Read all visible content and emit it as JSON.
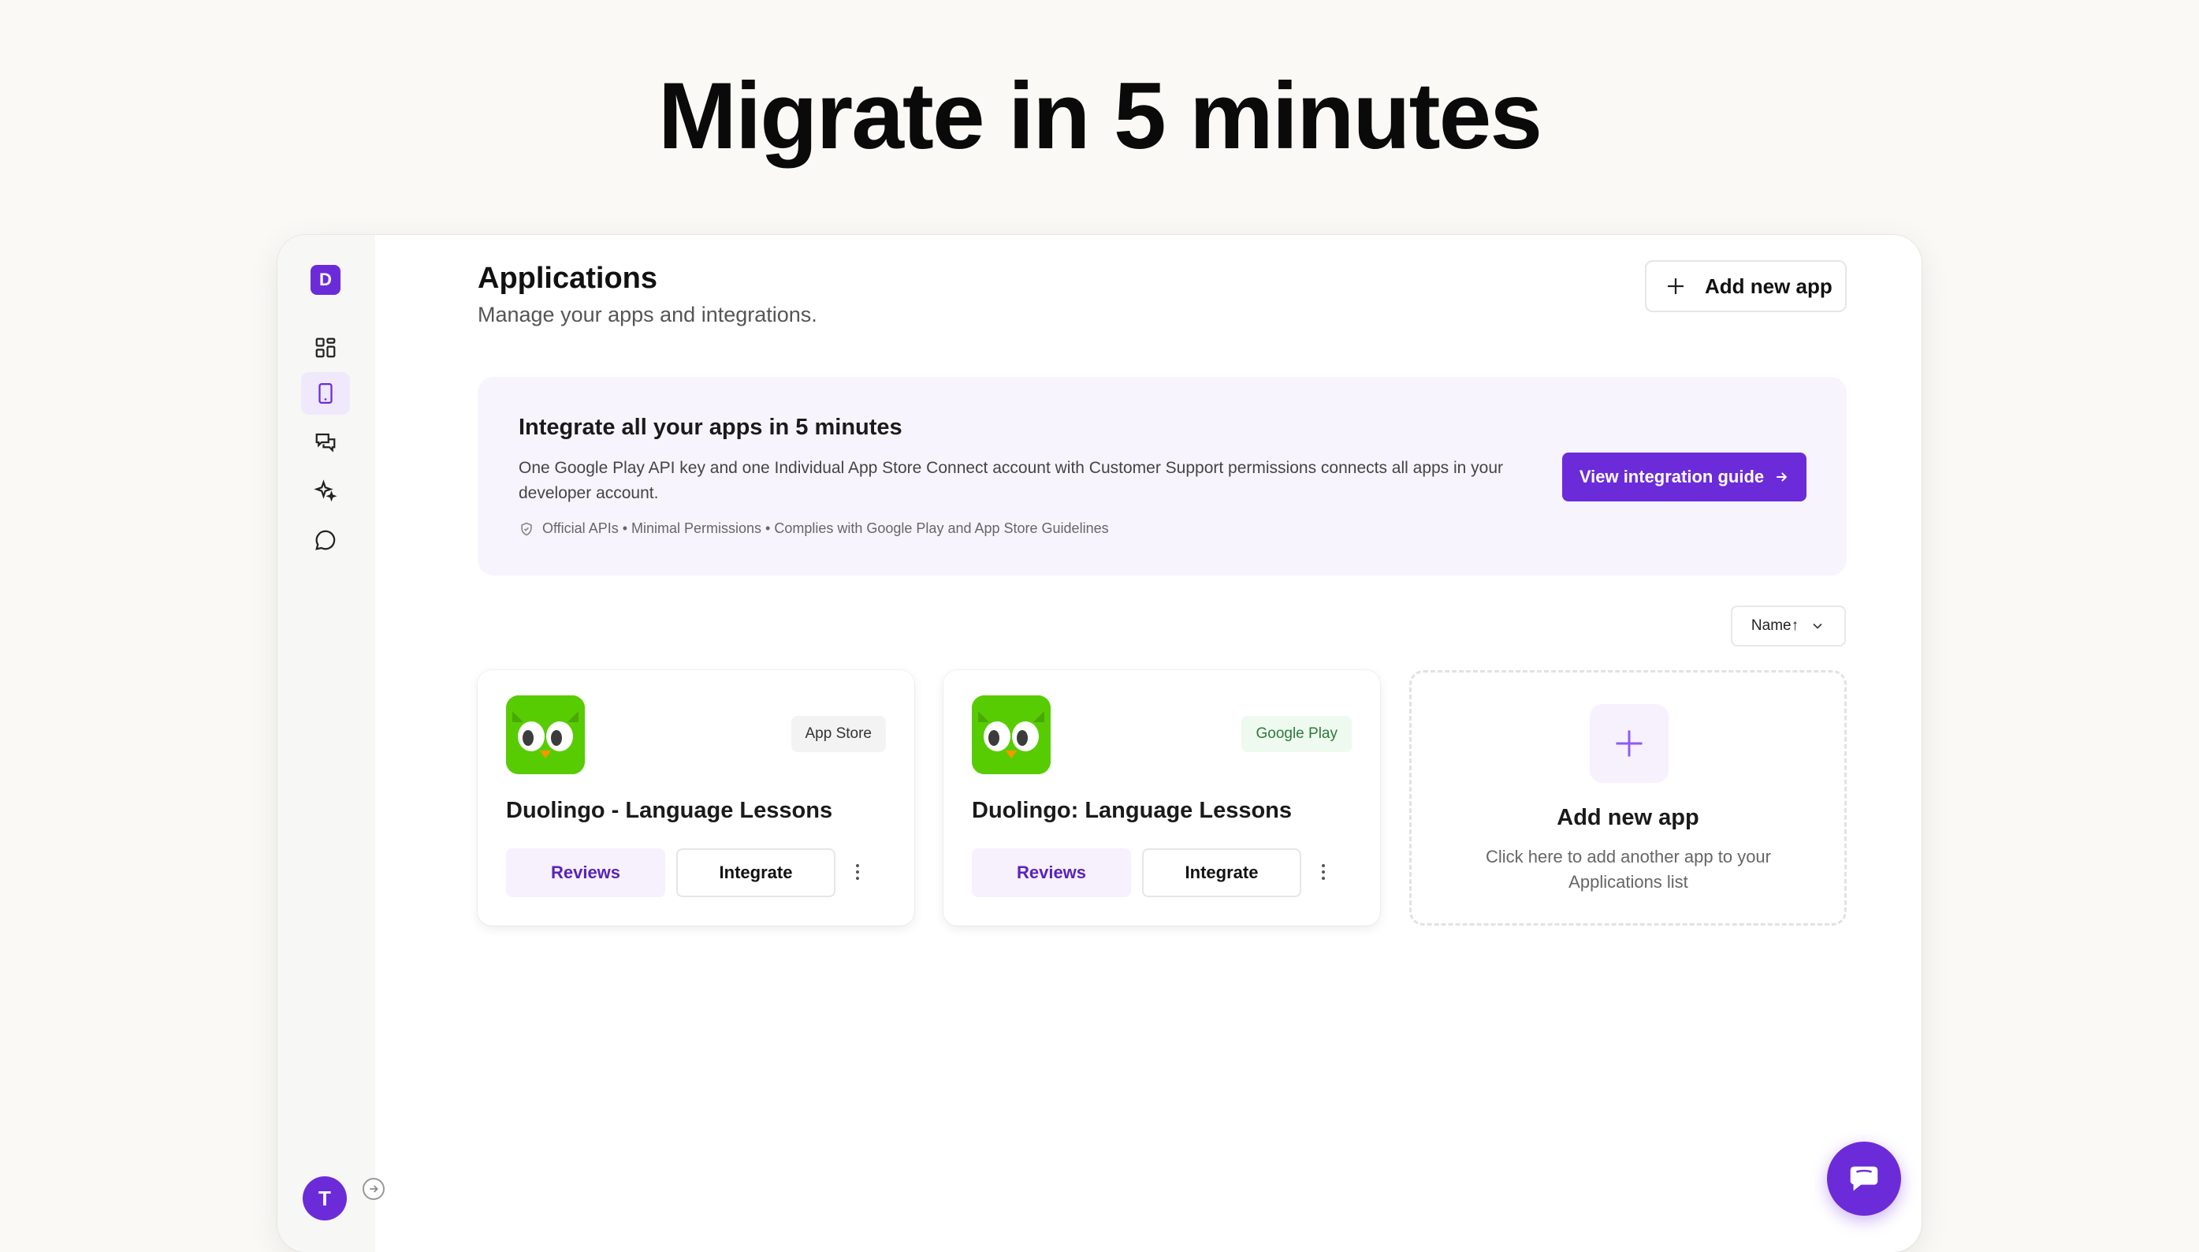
{
  "hero": {
    "title": "Migrate in 5 minutes"
  },
  "sidebar": {
    "logo_letter": "D",
    "items": [
      {
        "name": "dashboard",
        "icon": "grid-icon",
        "active": false
      },
      {
        "name": "applications",
        "icon": "mobile-device-icon",
        "active": true
      },
      {
        "name": "reviews",
        "icon": "chat-bubbles-icon",
        "active": false
      },
      {
        "name": "ai",
        "icon": "sparkles-icon",
        "active": false
      },
      {
        "name": "messages",
        "icon": "message-circle-icon",
        "active": false
      }
    ],
    "avatar_letter": "T",
    "collapse_icon": "arrow-right-circle-icon"
  },
  "header": {
    "title": "Applications",
    "subtitle": "Manage your apps and integrations.",
    "add_button_label": "Add new app"
  },
  "banner": {
    "title": "Integrate all your apps in 5 minutes",
    "description": "One Google Play API key and one Individual App Store Connect account with Customer Support permissions connects all apps in your developer account.",
    "meta": "Official APIs • Minimal Permissions • Complies with Google Play and App Store Guidelines",
    "button_label": "View integration guide"
  },
  "sort": {
    "label": "Name",
    "direction": "ascending"
  },
  "apps": [
    {
      "name": "Duolingo - Language Lessons",
      "store": "App Store",
      "reviews_label": "Reviews",
      "integrate_label": "Integrate"
    },
    {
      "name": "Duolingo: Language Lessons",
      "store": "Google Play",
      "reviews_label": "Reviews",
      "integrate_label": "Integrate"
    }
  ],
  "add_card": {
    "title": "Add new app",
    "description": "Click here to add another app to your Applications list"
  },
  "colors": {
    "accent": "#6c2bd9",
    "banner_bg": "#f8f4fd",
    "app_icon_green": "#58cc02"
  }
}
